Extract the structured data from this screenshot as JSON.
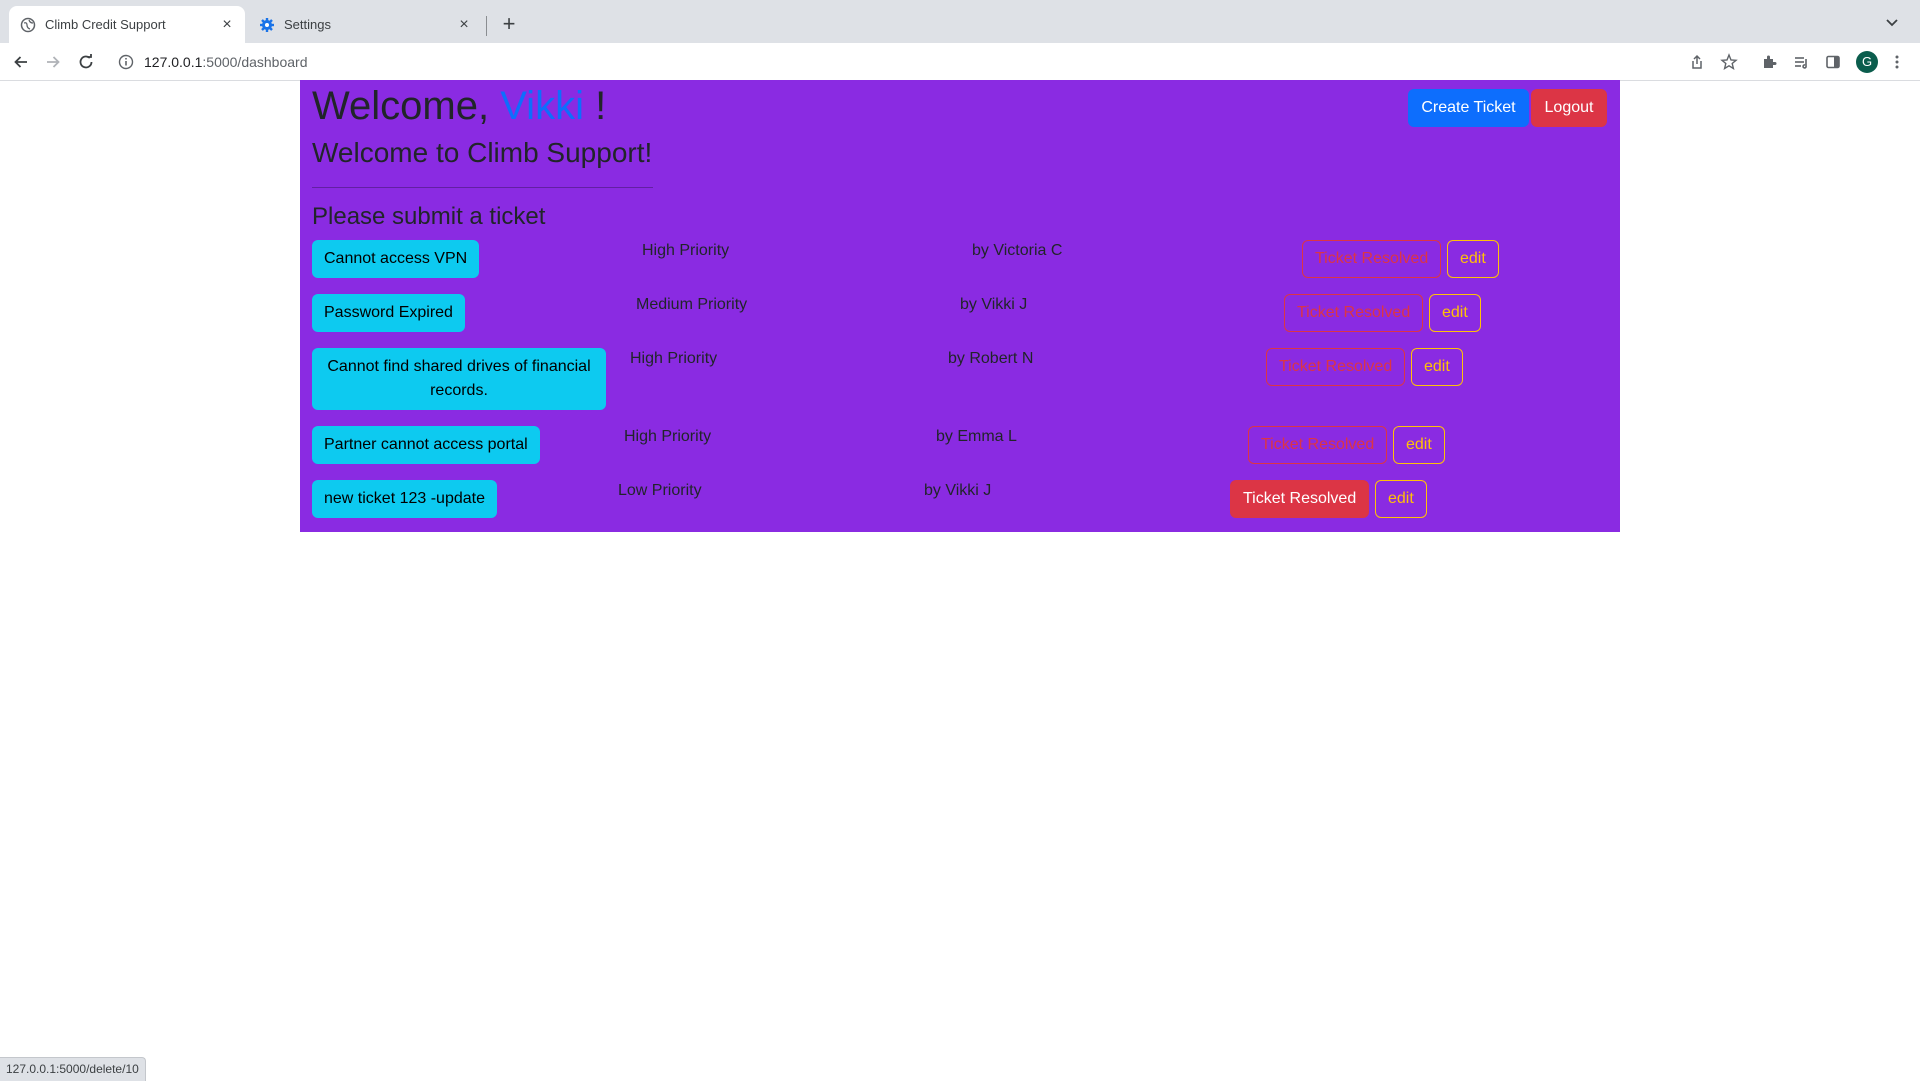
{
  "browser": {
    "tabs": [
      {
        "title": "Climb Credit Support",
        "icon": "globe-icon",
        "active": true
      },
      {
        "title": "Settings",
        "icon": "gear-icon",
        "active": false
      }
    ],
    "url_host": "127.0.0.1",
    "url_rest": ":5000/dashboard",
    "profile_initial": "G",
    "status_url": "127.0.0.1:5000/delete/10"
  },
  "page": {
    "welcome_prefix": "Welcome,",
    "user_name": "Vikki",
    "welcome_suffix": "!",
    "subtitle": "Welcome to Climb Support!",
    "submit_heading": "Please submit a ticket",
    "create_ticket_label": "Create Ticket",
    "logout_label": "Logout",
    "resolve_label": "Ticket Resolved",
    "edit_label": "edit"
  },
  "tickets": [
    {
      "title": "Cannot access VPN",
      "priority": "High Priority",
      "author": "by Victoria C",
      "resolved_highlight": false
    },
    {
      "title": "Password Expired",
      "priority": "Medium Priority",
      "author": "by Vikki J",
      "resolved_highlight": false
    },
    {
      "title": "Cannot find shared drives of financial records.",
      "priority": "High Priority",
      "author": "by Robert N",
      "resolved_highlight": false
    },
    {
      "title": "Partner cannot access portal",
      "priority": "High Priority",
      "author": "by Emma L",
      "resolved_highlight": false
    },
    {
      "title": "new ticket 123 -update",
      "priority": "Low Priority",
      "author": "by Vikki J",
      "resolved_highlight": true
    }
  ],
  "colors": {
    "panel_bg": "#8a2be2",
    "user_name": "#0d6efd",
    "ticket_button": "#0dcaf0",
    "danger": "#dc3545",
    "warning": "#ffc107"
  }
}
